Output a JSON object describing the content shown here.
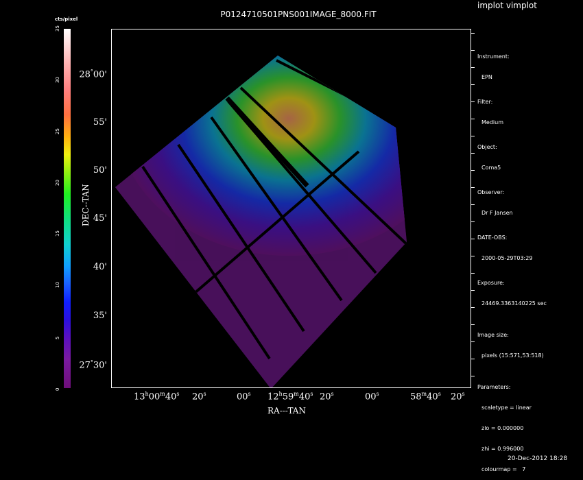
{
  "app_title": "implot vimplot",
  "plot_title": "P0124710501PNS001IMAGE_8000.FIT",
  "colorbar": {
    "label": "cts/pixel",
    "ticks": [
      "0",
      "5",
      "10",
      "15",
      "20",
      "25",
      "30",
      "35"
    ]
  },
  "axes": {
    "ylabel": "DEC--TAN",
    "xlabel": "RA---TAN",
    "yticks": [
      {
        "deg": "28",
        "min": "00",
        "sym": "°",
        "suf": "'"
      },
      {
        "deg": "",
        "min": "55",
        "sym": "",
        "suf": "'"
      },
      {
        "deg": "",
        "min": "50",
        "sym": "",
        "suf": "'"
      },
      {
        "deg": "",
        "min": "45",
        "sym": "",
        "suf": "'"
      },
      {
        "deg": "",
        "min": "40",
        "sym": "",
        "suf": "'"
      },
      {
        "deg": "",
        "min": "35",
        "sym": "",
        "suf": "'"
      },
      {
        "deg": "27",
        "min": "30",
        "sym": "°",
        "suf": "'"
      }
    ],
    "xticks": [
      {
        "h": "13",
        "m": "00",
        "s": "40"
      },
      {
        "h": "",
        "m": "",
        "s": "20"
      },
      {
        "h": "",
        "m": "",
        "s": "00"
      },
      {
        "h": "12",
        "m": "59",
        "s": "40"
      },
      {
        "h": "",
        "m": "",
        "s": "20"
      },
      {
        "h": "",
        "m": "",
        "s": "00"
      },
      {
        "h": "",
        "m": "58",
        "s": "40"
      },
      {
        "h": "",
        "m": "",
        "s": "20"
      }
    ]
  },
  "info": {
    "instrument_label": "Instrument:",
    "instrument": "EPN",
    "filter_label": "Filter:",
    "filter": "Medium",
    "object_label": "Object:",
    "object": "Coma5",
    "observer_label": "Observer:",
    "observer": "Dr F Jansen",
    "date_label": "DATE-OBS:",
    "date": "2000-05-29T03:29",
    "exposure_label": "Exposure:",
    "exposure": "24469.3363140225 sec",
    "size_label": "Image size:",
    "size": "pixels (15:571,53:518)",
    "params_label": "Parameters:",
    "scaletype": "scaletype = linear",
    "zlo": "zlo = 0.000000",
    "zhi": "zhi = 0.996000",
    "colourmap": "colourmap =   7"
  },
  "timestamp": "20-Dec-2012 18:28"
}
